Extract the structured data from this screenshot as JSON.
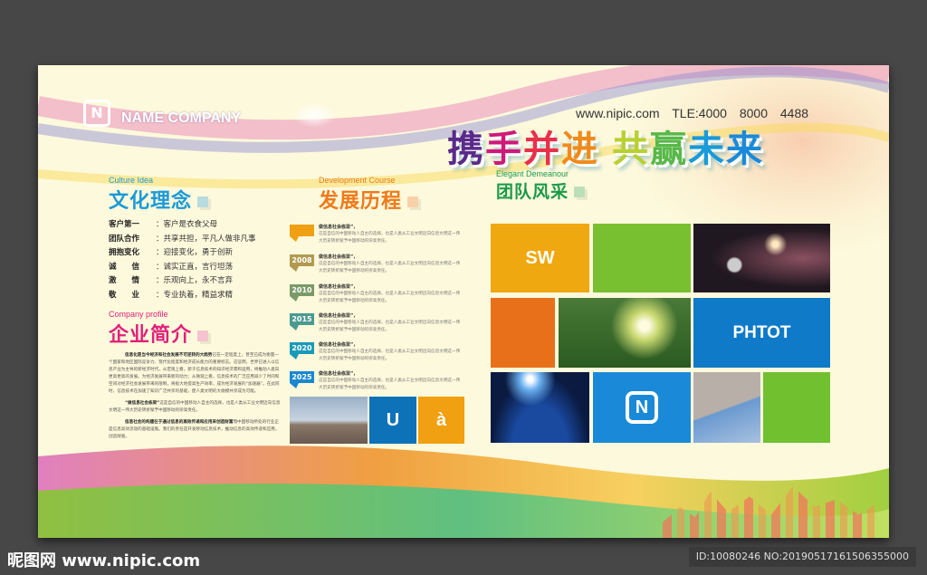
{
  "brand": {
    "logo_glyph": "N",
    "name": "NAME COMPANY"
  },
  "contact": {
    "website": "www.nipic.com",
    "phone": "TLE:4000 8000 4488"
  },
  "slogan": {
    "chars": [
      "携",
      "手",
      "并",
      "进",
      " ",
      "共",
      "赢",
      "未",
      "来"
    ],
    "colors": [
      "#5a2a8a",
      "#d0187a",
      "#e8304a",
      "#f08a1a",
      "#fff",
      "#b8d030",
      "#58b848",
      "#1a9ad8",
      "#1a8ad8"
    ]
  },
  "culture": {
    "en": "Culture Idea",
    "cn": "文化理念",
    "color": "#1a9ad8",
    "rows": [
      {
        "k": "客户第一",
        "v": "：客户是衣食父母"
      },
      {
        "k": "团队合作",
        "v": "：共享共担，平凡人做非凡事"
      },
      {
        "k": "拥抱变化",
        "v": "：迎接变化，勇于创新"
      },
      {
        "k": "诚　　信",
        "v": "：诚实正直，言行坦荡"
      },
      {
        "k": "激　　情",
        "v": "：乐观向上，永不言弃"
      },
      {
        "k": "敬　　业",
        "v": "：专业执着，精益求精"
      }
    ]
  },
  "profile": {
    "en": "Company profile",
    "cn": "企业简介",
    "color": "#e0207a",
    "paragraphs": [
      {
        "lead": "信息化是当今经济和社会发展不可逆转的大趋势",
        "text": "已在一定程度上，甚至已成为衡量一个国家和地区国际竞争力、现代化程度和经济成长能力的重要标志。这证明，世界已进入以信息产业为主导的新经济时代。从宏观上看，新于信息技术的知识经济需和运用，将推动人类向更高更高的发展。为经济发展带来新的动力；从微观上看，信息技术的广泛应用减少了时间和空间对经济社会发展带来的限制，将极大地提高生产效率，成为经济发展的“加速器”。在此同时，信息技术在加速了知识广泛共享的基础，使人类文明的大规模共享成为可能。"
      },
      {
        "lead": "“做信息社会栋梁”",
        "text": "这是自信的中国移动人自主的选择，也是人类从工业文明迈向信息文明这一伟大历史转折赋予中国移动的崇高责任。"
      },
      {
        "lead": "信息社会的构建在于通过信息的高效传递和应用来创造财富",
        "text": "而中国移动所处的行业正是信息高效流动的基础设施。我们的责任是开发移动信息技术，推动信息的高效传递和应用，创造财富。"
      }
    ]
  },
  "development": {
    "en": "Development Course",
    "cn": "发展历程",
    "color": "#ee7a1a",
    "items": [
      {
        "year": "",
        "color": "#f0a010",
        "title": "做信息社会栋梁”，",
        "desc": "这是自信的中国移动人自主的选择，也是人类从工业文明迈向信息文明这一伟大历史转折赋予中国移动的崇高责任。"
      },
      {
        "year": "2008",
        "color": "#b09a50",
        "title": "做信息社会栋梁”，",
        "desc": "这是自信的中国移动人自主的选择，也是人类从工业文明迈向信息文明这一伟大历史转折赋予中国移动的崇高责任。"
      },
      {
        "year": "2010",
        "color": "#7a9a68",
        "title": "做信息社会栋梁”，",
        "desc": "这是自信的中国移动人自主的选择，也是人类从工业文明迈向信息文明这一伟大历史转折赋予中国移动的崇高责任。"
      },
      {
        "year": "2015",
        "color": "#4a9a90",
        "title": "做信息社会栋梁”，",
        "desc": "这是自信的中国移动人自主的选择，也是人类从工业文明迈向信息文明这一伟大历史转折赋予中国移动的崇高责任。"
      },
      {
        "year": "2020",
        "color": "#1a9ab8",
        "title": "做信息社会栋梁”，",
        "desc": "这是自信的中国移动人自主的选择，也是人类从工业文明迈向信息文明这一伟大历史转折赋予中国移动的崇高责任。"
      },
      {
        "year": "2025",
        "color": "#1a88d0",
        "title": "做信息社会栋梁”，",
        "desc": "这是自信的中国移动人自主的选择，也是人类从工业文明迈向信息文明这一伟大历史转折赋予中国移动的崇高责任。"
      }
    ],
    "tiles": [
      {
        "label": "U",
        "color": "#0e72b8"
      },
      {
        "label": "à",
        "color": "#f0a010"
      }
    ]
  },
  "team": {
    "en": "Elegant Demeanour",
    "cn": "团队风采",
    "color": "#1a9a48",
    "tiles": {
      "sw": "SW",
      "phtot": "PHTOT",
      "logo": "N"
    }
  },
  "watermark": {
    "site": "昵图网 www.nipic.com",
    "id": "ID:10080246 NO:20190517161506355000"
  }
}
